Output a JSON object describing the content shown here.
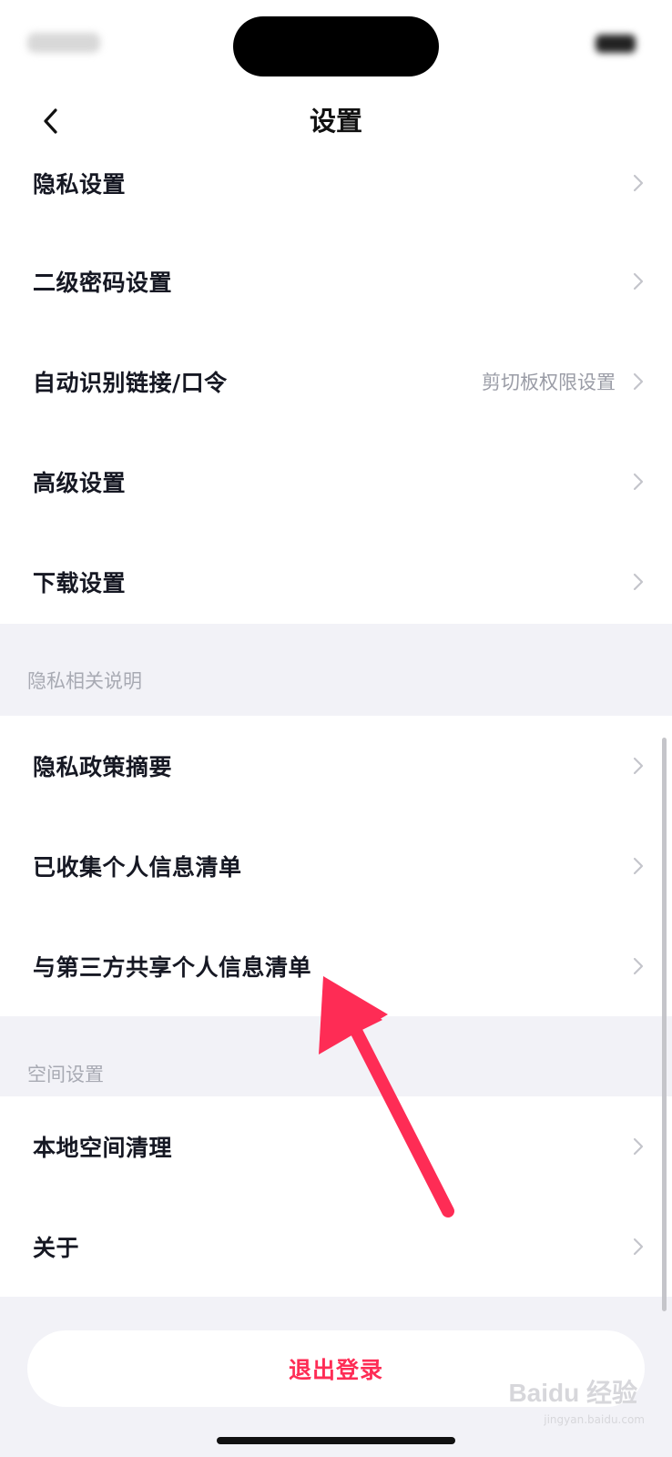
{
  "header": {
    "title": "设置"
  },
  "groups": [
    {
      "rows": [
        {
          "label": "隐私设置",
          "hint": ""
        },
        {
          "label": "二级密码设置",
          "hint": ""
        },
        {
          "label": "自动识别链接/口令",
          "hint": "剪切板权限设置"
        },
        {
          "label": "高级设置",
          "hint": ""
        },
        {
          "label": "下载设置",
          "hint": ""
        }
      ]
    },
    {
      "section_title": "隐私相关说明",
      "rows": [
        {
          "label": "隐私政策摘要"
        },
        {
          "label": "已收集个人信息清单"
        },
        {
          "label": "与第三方共享个人信息清单"
        }
      ]
    },
    {
      "section_title": "空间设置",
      "rows": [
        {
          "label": "本地空间清理"
        },
        {
          "label": "关于"
        }
      ]
    }
  ],
  "logout_label": "退出登录",
  "watermark": {
    "logo_text": "Baidu 经验",
    "url": "jingyan.baidu.com"
  },
  "colors": {
    "accent": "#fe2c55",
    "arrow": "#fe2c55",
    "background": "#f2f2f7"
  }
}
